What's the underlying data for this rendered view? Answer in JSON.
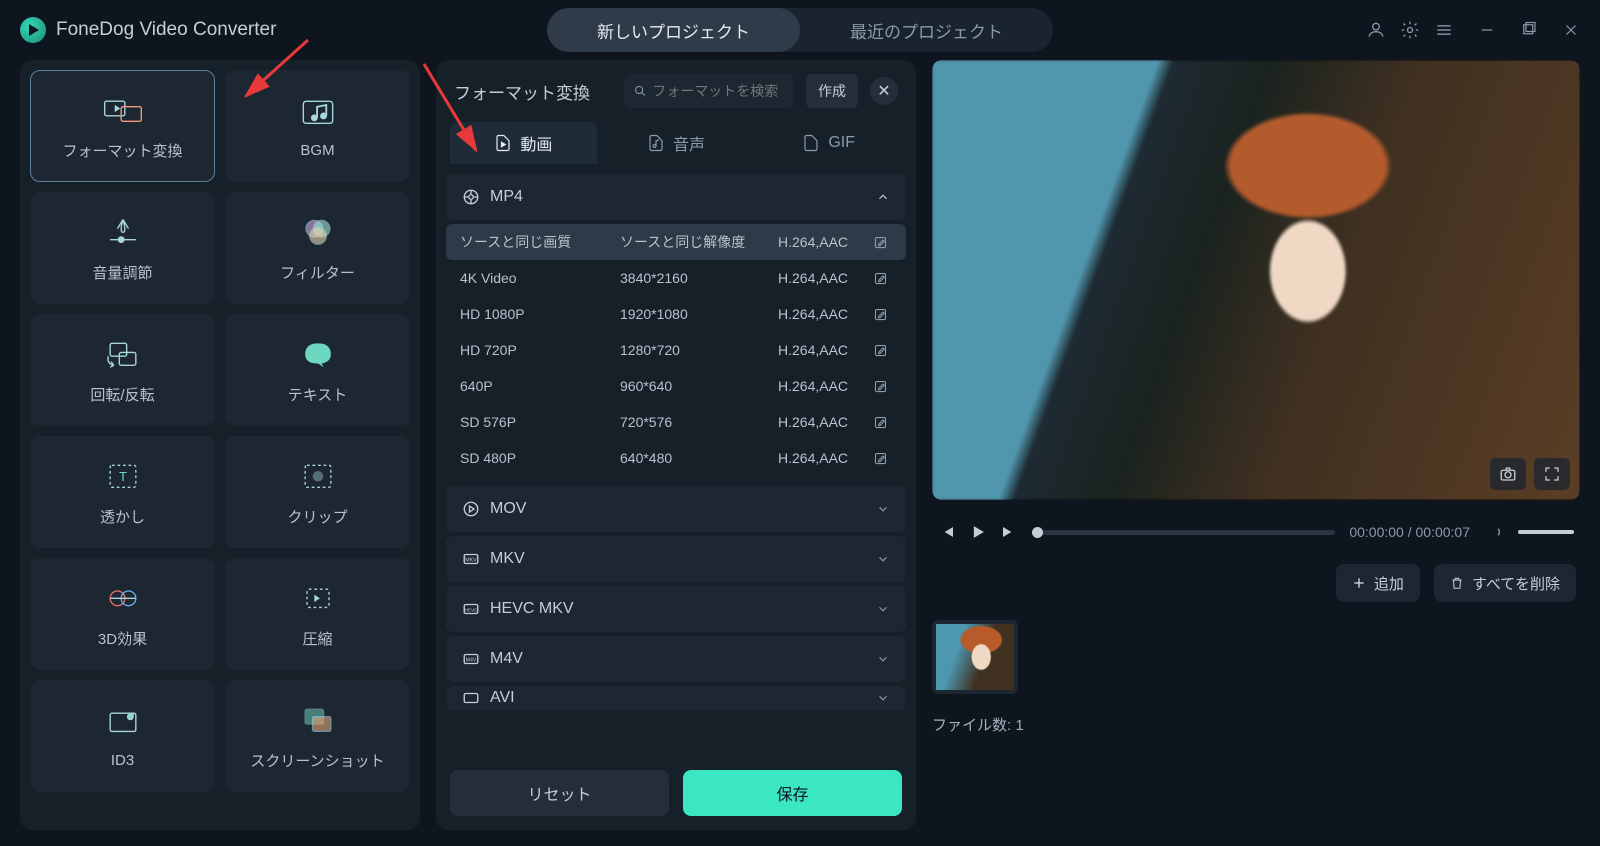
{
  "app": {
    "title": "FoneDog Video Converter"
  },
  "header": {
    "tabs": [
      {
        "label": "新しいプロジェクト",
        "active": true
      },
      {
        "label": "最近のプロジェクト",
        "active": false
      }
    ]
  },
  "tools": [
    {
      "id": "format-convert",
      "label": "フォーマット変換",
      "selected": true,
      "icon": "convert"
    },
    {
      "id": "bgm",
      "label": "BGM",
      "selected": false,
      "icon": "bgm"
    },
    {
      "id": "volume",
      "label": "音量調節",
      "selected": false,
      "icon": "volume"
    },
    {
      "id": "filter",
      "label": "フィルター",
      "selected": false,
      "icon": "filter"
    },
    {
      "id": "rotate",
      "label": "回転/反転",
      "selected": false,
      "icon": "rotate"
    },
    {
      "id": "text",
      "label": "テキスト",
      "selected": false,
      "icon": "text"
    },
    {
      "id": "watermark",
      "label": "透かし",
      "selected": false,
      "icon": "watermark"
    },
    {
      "id": "clip",
      "label": "クリップ",
      "selected": false,
      "icon": "clip"
    },
    {
      "id": "3d",
      "label": "3D効果",
      "selected": false,
      "icon": "3d"
    },
    {
      "id": "compress",
      "label": "圧縮",
      "selected": false,
      "icon": "compress"
    },
    {
      "id": "id3",
      "label": "ID3",
      "selected": false,
      "icon": "id3"
    },
    {
      "id": "screenshot",
      "label": "スクリーンショット",
      "selected": false,
      "icon": "screenshot"
    }
  ],
  "center": {
    "title": "フォーマット変換",
    "search_placeholder": "フォーマットを検索",
    "create_label": "作成",
    "type_tabs": [
      {
        "label": "動画",
        "active": true
      },
      {
        "label": "音声",
        "active": false
      },
      {
        "label": "GIF",
        "active": false
      }
    ],
    "groups": [
      {
        "name": "MP4",
        "expanded": true,
        "presets": [
          {
            "quality": "ソースと同じ画質",
            "resolution": "ソースと同じ解像度",
            "codec": "H.264,AAC",
            "selected": true
          },
          {
            "quality": "4K Video",
            "resolution": "3840*2160",
            "codec": "H.264,AAC",
            "selected": false
          },
          {
            "quality": "HD 1080P",
            "resolution": "1920*1080",
            "codec": "H.264,AAC",
            "selected": false
          },
          {
            "quality": "HD 720P",
            "resolution": "1280*720",
            "codec": "H.264,AAC",
            "selected": false
          },
          {
            "quality": "640P",
            "resolution": "960*640",
            "codec": "H.264,AAC",
            "selected": false
          },
          {
            "quality": "SD 576P",
            "resolution": "720*576",
            "codec": "H.264,AAC",
            "selected": false
          },
          {
            "quality": "SD 480P",
            "resolution": "640*480",
            "codec": "H.264,AAC",
            "selected": false
          }
        ]
      },
      {
        "name": "MOV",
        "expanded": false
      },
      {
        "name": "MKV",
        "expanded": false
      },
      {
        "name": "HEVC MKV",
        "expanded": false
      },
      {
        "name": "M4V",
        "expanded": false
      },
      {
        "name": "AVI",
        "expanded": false
      }
    ],
    "reset_label": "リセット",
    "save_label": "保存"
  },
  "preview": {
    "current_time": "00:00:00",
    "total_time": "00:00:07"
  },
  "right": {
    "add_label": "追加",
    "delete_all_label": "すべてを削除",
    "file_count_label": "ファイル数:",
    "file_count": "1"
  }
}
